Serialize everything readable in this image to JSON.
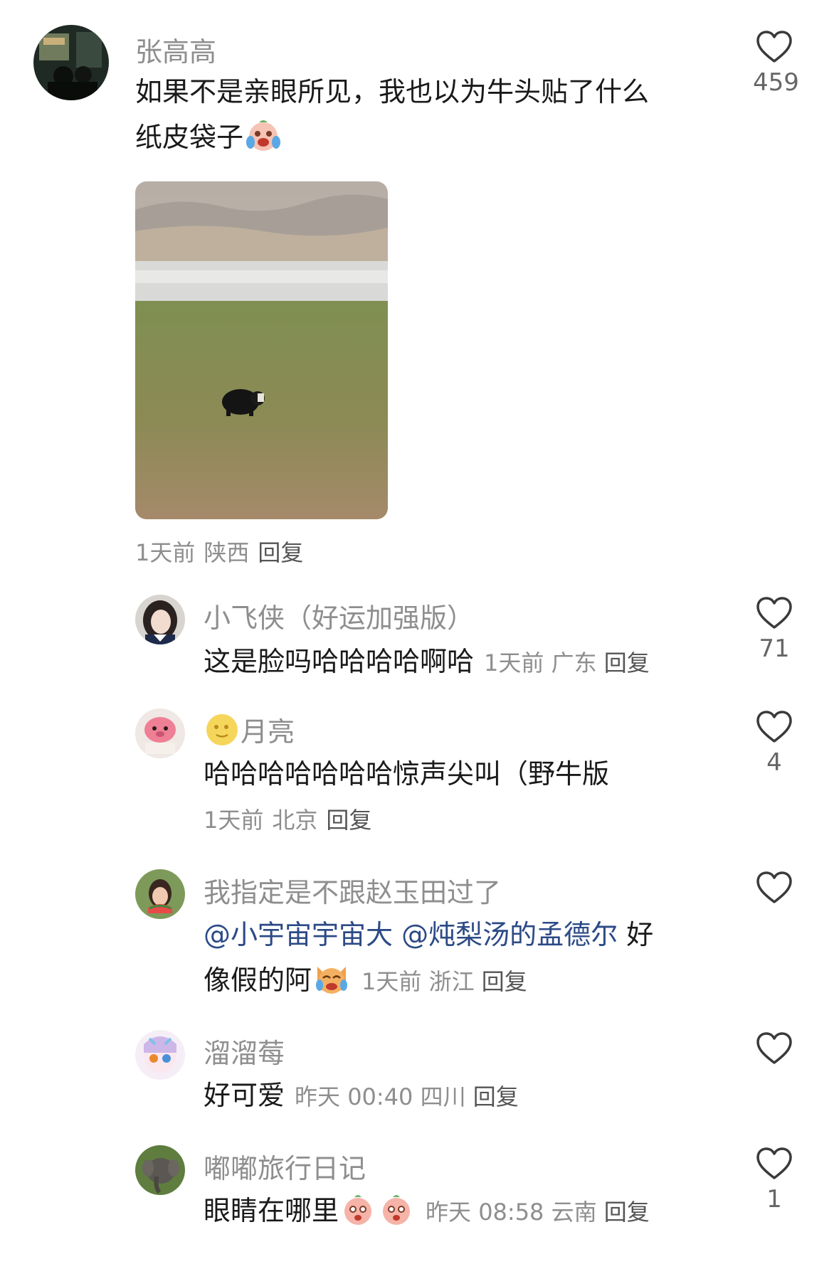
{
  "main_comment": {
    "username": "张高高",
    "text_line1": "如果不是亲眼所见，我也以为牛头贴了什么",
    "text_line2": "纸皮袋子",
    "emoji_icon": "crying-laughing-face-emoji",
    "time": "1天前",
    "location": "陕西",
    "reply_label": "回复",
    "likes": "459"
  },
  "replies": [
    {
      "username": "小飞侠（好运加强版）",
      "text": "这是脸吗哈哈哈哈啊哈",
      "time": "1天前",
      "location": "广东",
      "reply_label": "回复",
      "likes": "71"
    },
    {
      "username": "月亮",
      "username_emoji": "moon-face-emoji",
      "text": "哈哈哈哈哈哈哈惊声尖叫（野牛版",
      "time": "1天前",
      "location": "北京",
      "reply_label": "回复",
      "likes": "4"
    },
    {
      "username": "我指定是不跟赵玉田过了",
      "mention1": "@小宇宙宇宙大",
      "mention2": "@炖梨汤的孟德尔",
      "text_tail1": "好",
      "text_line2": "像假的阿",
      "emoji_icon": "laughing-cat-emoji",
      "time": "1天前",
      "location": "浙江",
      "reply_label": "回复",
      "likes": ""
    },
    {
      "username": "溜溜莓",
      "text": "好可爱",
      "time": "昨天 00:40",
      "location": "四川",
      "reply_label": "回复",
      "likes": ""
    },
    {
      "username": "嘟嘟旅行日记",
      "text": "眼睛在哪里",
      "emoji_icon": "peach-face-emoji",
      "time": "昨天 08:58",
      "location": "云南",
      "reply_label": "回复",
      "likes": "1"
    }
  ],
  "colors": {
    "name_gray": "#8e8e8e",
    "text": "#1a1a1a",
    "mention": "#2c4a86",
    "icon_gray": "#3a3a3a"
  }
}
